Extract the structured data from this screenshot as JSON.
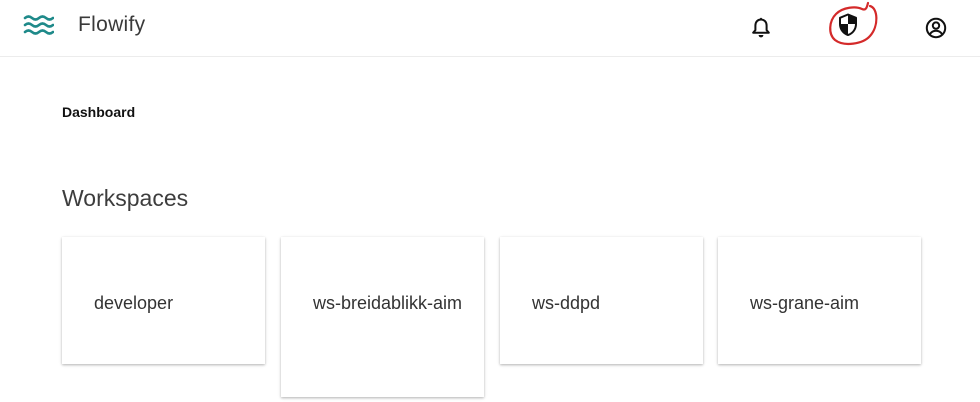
{
  "header": {
    "logo_icon": "waves-icon",
    "brand": "Flowify",
    "brand_color": "#1f8a8a",
    "actions": [
      {
        "name": "notifications",
        "icon": "bell-icon"
      },
      {
        "name": "security",
        "icon": "shield-icon"
      },
      {
        "name": "account",
        "icon": "user-circle-icon"
      }
    ],
    "annotation_color": "#d42a2a"
  },
  "breadcrumb": "Dashboard",
  "workspaces": {
    "title": "Workspaces",
    "items": [
      {
        "label": "developer"
      },
      {
        "label": "ws-breidablikk-aim"
      },
      {
        "label": "ws-ddpd"
      },
      {
        "label": "ws-grane-aim"
      }
    ]
  }
}
